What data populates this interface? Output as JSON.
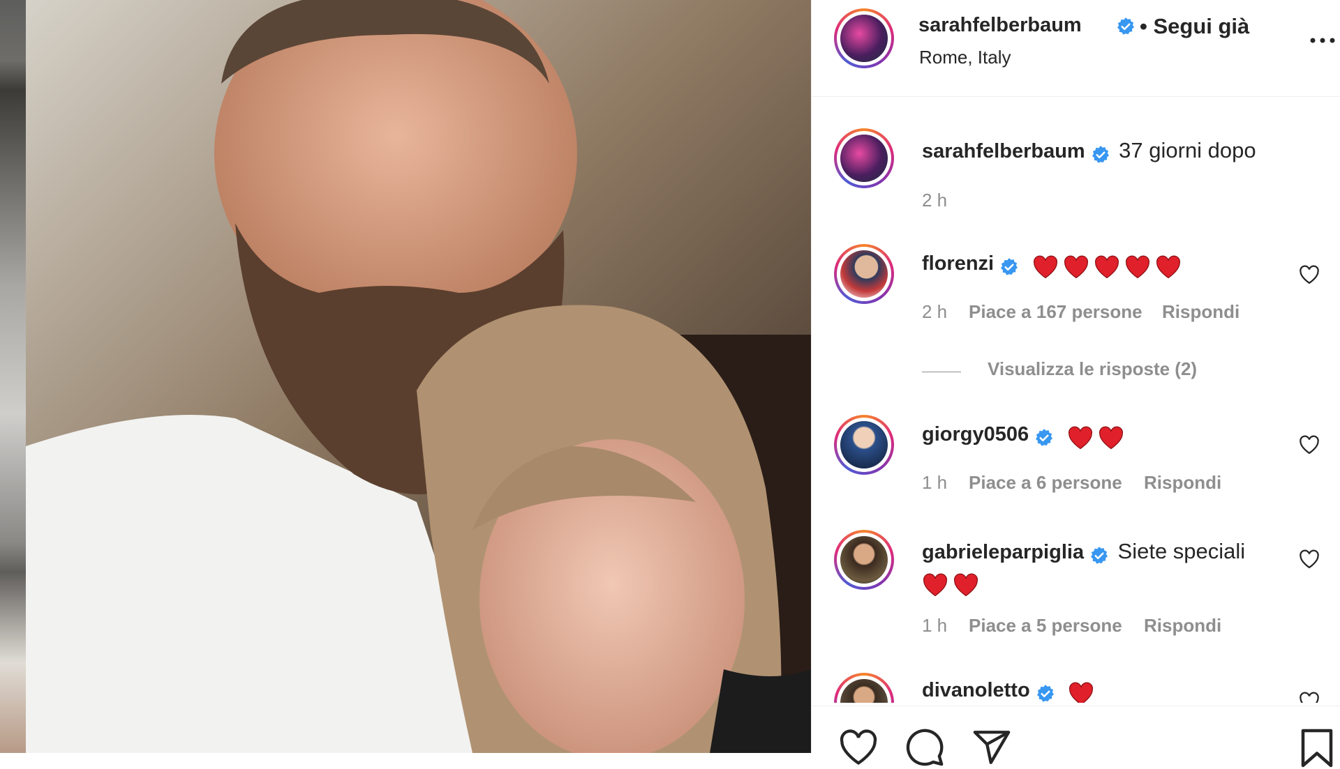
{
  "header": {
    "username": "sarahfelberbaum",
    "follow_status": "• Segui già",
    "location": "Rome, Italy",
    "more_icon": "more-horizontal-icon"
  },
  "caption": {
    "username": "sarahfelberbaum",
    "text": "37 giorni dopo",
    "time": "2 h"
  },
  "comments": [
    {
      "username": "florenzi",
      "text": "",
      "hearts": 5,
      "time": "2 h",
      "likes": "Piace a 167 persone",
      "reply": "Rispondi",
      "view_replies": "Visualizza le risposte (2)"
    },
    {
      "username": "giorgy0506",
      "text": "",
      "hearts": 2,
      "time": "1 h",
      "likes": "Piace a 6 persone",
      "reply": "Rispondi"
    },
    {
      "username": "gabrieleparpiglia",
      "text": "Siete speciali",
      "hearts": 2,
      "time": "1 h",
      "likes": "Piace a 5 persone",
      "reply": "Rispondi"
    },
    {
      "username": "divanoletto",
      "text": "",
      "hearts": 1
    }
  ],
  "actions": {
    "icons": [
      "heart-icon",
      "comment-icon",
      "share-icon",
      "bookmark-icon"
    ]
  },
  "colors": {
    "verified": "#3897f0",
    "heart": "#e0202a",
    "muted": "#8e8e8e"
  }
}
